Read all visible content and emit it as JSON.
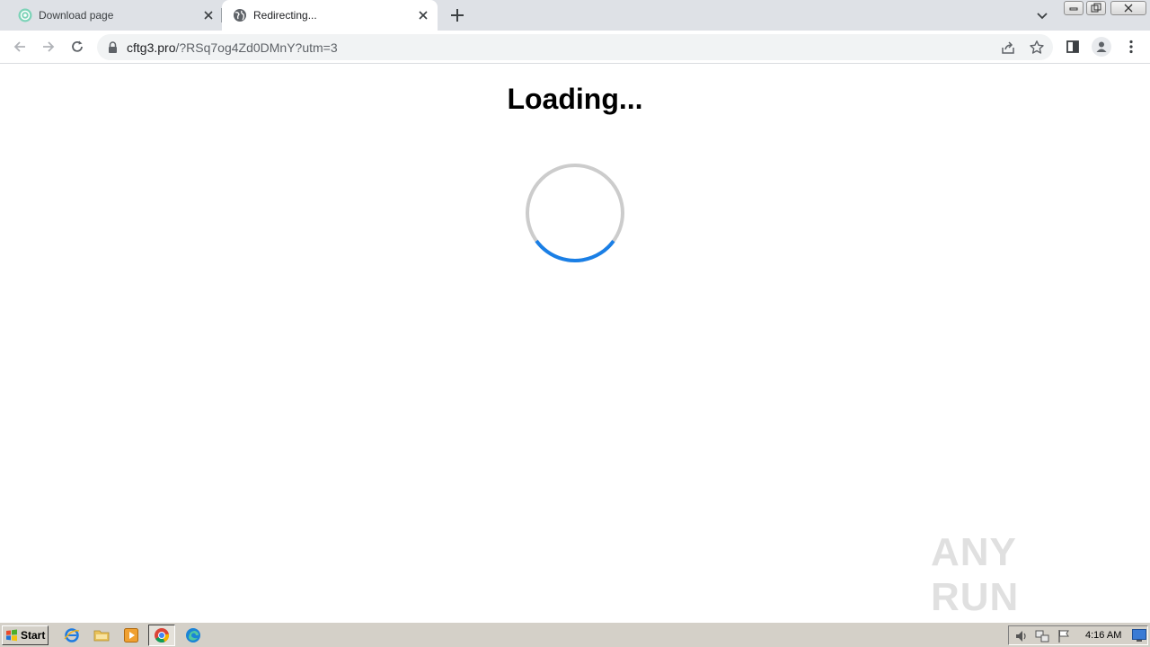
{
  "tabs": [
    {
      "title": "Download page",
      "active": false,
      "favicon": "green-circle-favicon-icon"
    },
    {
      "title": "Redirecting...",
      "active": true,
      "favicon": "globe-icon"
    }
  ],
  "toolbar": {
    "url_host": "cftg3.pro",
    "url_path": "/?RSq7og4Zd0DMnY?utm=3"
  },
  "page": {
    "heading": "Loading...",
    "spinner_progress": 0.3
  },
  "watermark": {
    "text": "ANY RUN"
  },
  "taskbar": {
    "start_label": "Start",
    "clock": "4:16 AM",
    "quick_launch": [
      "internet-explorer-icon",
      "folder-icon",
      "media-player-icon",
      "chrome-icon",
      "edge-icon"
    ]
  },
  "colors": {
    "tabstrip": "#dee1e6",
    "spinner_track": "#cccccc",
    "spinner_arc": "#1a7fe6",
    "taskbar": "#d4d0c8"
  }
}
